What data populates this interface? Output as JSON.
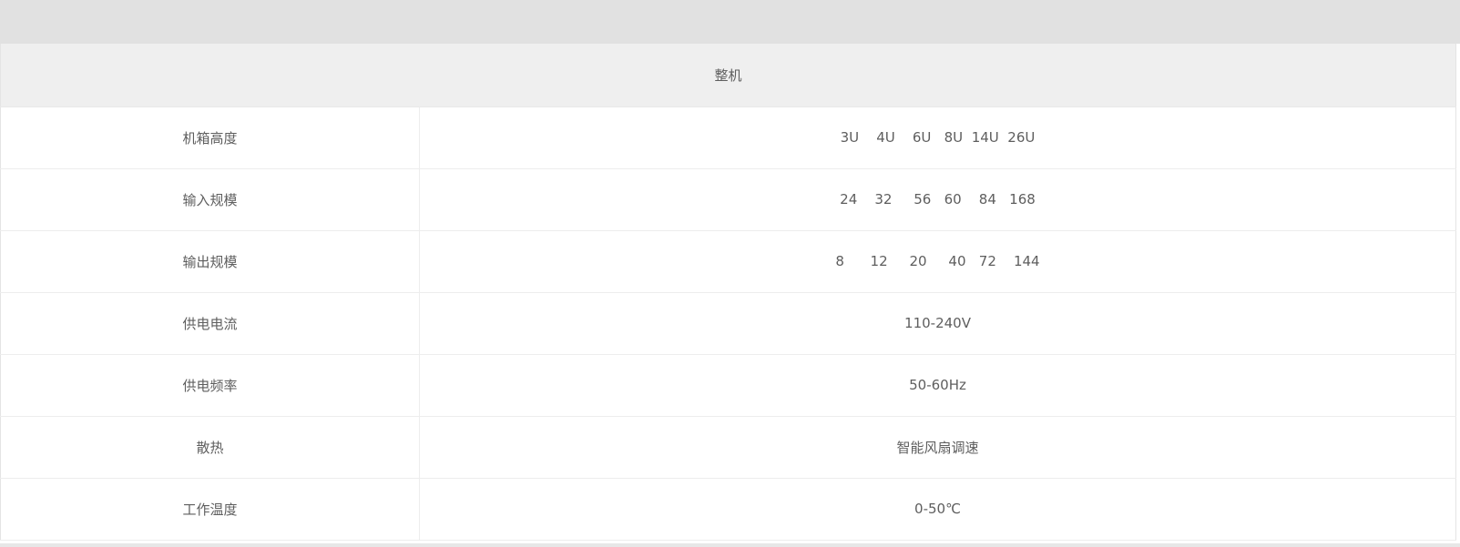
{
  "table": {
    "header": "整机",
    "rows": [
      {
        "label": "机箱高度",
        "value": "3U    4U    6U   8U  14U  26U"
      },
      {
        "label": "输入规模",
        "value": "24    32     56   60    84   168"
      },
      {
        "label": "输出规模",
        "value": "8      12     20     40   72    144"
      },
      {
        "label": "供电电流",
        "value": "110-240V"
      },
      {
        "label": "供电频率",
        "value": "50-60Hz"
      },
      {
        "label": "散热",
        "value": "智能风扇调速"
      },
      {
        "label": "工作温度",
        "value": "0-50℃"
      }
    ]
  }
}
